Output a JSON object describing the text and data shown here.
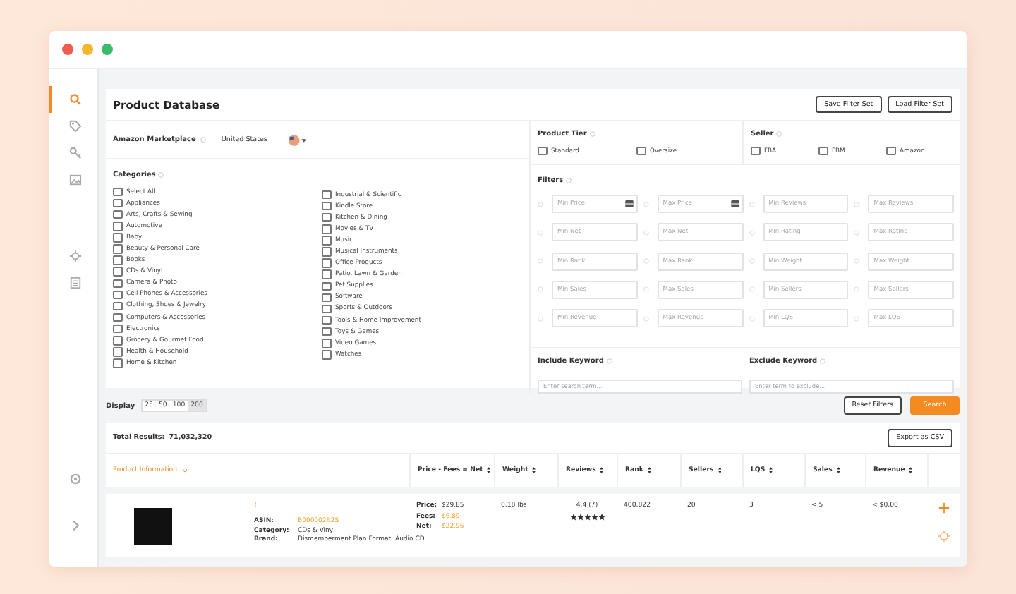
{
  "window_controls": [
    {
      "color": "#ee5b4f"
    },
    {
      "color": "#f4b52f"
    },
    {
      "color": "#3dbb6b"
    }
  ],
  "sidebar": {
    "items": [
      {
        "kind": "search",
        "selected": true
      },
      {
        "kind": "tag",
        "selected": false
      },
      {
        "kind": "key",
        "selected": false
      },
      {
        "kind": "image",
        "selected": false
      },
      {
        "kind": "crosshair",
        "selected": false
      },
      {
        "kind": "list",
        "selected": false
      }
    ],
    "bottom_items": [
      {
        "kind": "settings",
        "selected": false
      },
      {
        "kind": "expand",
        "selected": false
      }
    ]
  },
  "header": {
    "title": "Product Database",
    "buttons": [
      "Save Filter Set",
      "Load Filter Set"
    ]
  },
  "marketplace": {
    "label": "Amazon Marketplace",
    "value": "United States"
  },
  "categories": {
    "label": "Categories",
    "columns": [
      [
        {
          "label": "Select All",
          "checked": false
        },
        {
          "label": "Appliances",
          "checked": false
        },
        {
          "label": "Arts, Crafts & Sewing",
          "checked": false
        },
        {
          "label": "Automotive",
          "checked": false
        },
        {
          "label": "Baby",
          "checked": false
        },
        {
          "label": "Beauty & Personal Care",
          "checked": false
        },
        {
          "label": "Books",
          "checked": false
        },
        {
          "label": "CDs & Vinyl",
          "checked": false
        },
        {
          "label": "Camera & Photo",
          "checked": false
        },
        {
          "label": "Cell Phones & Accessories",
          "checked": false
        },
        {
          "label": "Clothing, Shoes & Jewelry",
          "checked": false
        },
        {
          "label": "Computers & Accessories",
          "checked": false
        },
        {
          "label": "Electronics",
          "checked": false
        },
        {
          "label": "Grocery & Gourmet Food",
          "checked": false
        },
        {
          "label": "Health & Household",
          "checked": false
        },
        {
          "label": "Home & Kitchen",
          "checked": false
        }
      ],
      [
        {
          "label": "Industrial & Scientific",
          "checked": false
        },
        {
          "label": "Kindle Store",
          "checked": false
        },
        {
          "label": "Kitchen & Dining",
          "checked": false
        },
        {
          "label": "Movies & TV",
          "checked": false
        },
        {
          "label": "Music",
          "checked": false
        },
        {
          "label": "Musical Instruments",
          "checked": false
        },
        {
          "label": "Office Products",
          "checked": false
        },
        {
          "label": "Patio, Lawn & Garden",
          "checked": false
        },
        {
          "label": "Pet Supplies",
          "checked": false
        },
        {
          "label": "Software",
          "checked": false
        },
        {
          "label": "Sports & Outdoors",
          "checked": false
        },
        {
          "label": "Tools & Home Improvement",
          "checked": false
        },
        {
          "label": "Toys & Games",
          "checked": false
        },
        {
          "label": "Video Games",
          "checked": false
        },
        {
          "label": "Watches",
          "checked": false
        }
      ]
    ]
  },
  "product_tier": {
    "label": "Product Tier",
    "options": [
      {
        "label": "Standard",
        "checked": false
      },
      {
        "label": "Oversize",
        "checked": false
      }
    ]
  },
  "seller": {
    "label": "Seller",
    "options": [
      {
        "label": "FBA",
        "checked": false
      },
      {
        "label": "FBM",
        "checked": false
      },
      {
        "label": "Amazon",
        "checked": false
      }
    ]
  },
  "filters": {
    "label": "Filters",
    "fields": [
      {
        "placeholder": "Min Price",
        "kind": "price"
      },
      {
        "placeholder": "Max Price",
        "kind": "price"
      },
      {
        "placeholder": "Min Reviews",
        "kind": "plain"
      },
      {
        "placeholder": "Max Reviews",
        "kind": "plain"
      },
      {
        "placeholder": "Min Net",
        "kind": "plain"
      },
      {
        "placeholder": "Max Net",
        "kind": "plain"
      },
      {
        "placeholder": "Min Rating",
        "kind": "plain"
      },
      {
        "placeholder": "Max Rating",
        "kind": "plain"
      },
      {
        "placeholder": "Min Rank",
        "kind": "plain"
      },
      {
        "placeholder": "Max Rank",
        "kind": "plain"
      },
      {
        "placeholder": "Min Weight",
        "kind": "plain"
      },
      {
        "placeholder": "Max Weight",
        "kind": "plain"
      },
      {
        "placeholder": "Min Sales",
        "kind": "plain"
      },
      {
        "placeholder": "Max Sales",
        "kind": "plain"
      },
      {
        "placeholder": "Min Sellers",
        "kind": "plain"
      },
      {
        "placeholder": "Max Sellers",
        "kind": "plain"
      },
      {
        "placeholder": "Min Revenue",
        "kind": "plain"
      },
      {
        "placeholder": "Max Revenue",
        "kind": "plain"
      },
      {
        "placeholder": "Min LQS",
        "kind": "plain"
      },
      {
        "placeholder": "Max LQS",
        "kind": "plain"
      }
    ]
  },
  "include_keyword": {
    "label": "Include Keyword",
    "placeholder": "Enter search term..."
  },
  "exclude_keyword": {
    "label": "Exclude Keyword",
    "placeholder": "Enter term to exclude..."
  },
  "display": {
    "label": "Display",
    "options": [
      {
        "label": "25",
        "selected": false
      },
      {
        "label": "50",
        "selected": false
      },
      {
        "label": "100",
        "selected": false
      },
      {
        "label": "200",
        "selected": true
      }
    ]
  },
  "actions": {
    "reset": "Reset Filters",
    "search": "Search"
  },
  "results": {
    "total_label": "Total Results:",
    "total": "71,032,320",
    "export": "Export as CSV",
    "columns": [
      {
        "label": "Product Information",
        "kind": "primary"
      },
      {
        "label": "Price - Fees = Net",
        "kind": "sortable"
      },
      {
        "label": "Weight",
        "kind": "sortable"
      },
      {
        "label": "Reviews",
        "kind": "sortable"
      },
      {
        "label": "Rank",
        "kind": "sortable"
      },
      {
        "label": "Sellers",
        "kind": "sortable"
      },
      {
        "label": "LQS",
        "kind": "sortable"
      },
      {
        "label": "Sales",
        "kind": "sortable"
      },
      {
        "label": "Revenue",
        "kind": "sortable"
      }
    ]
  },
  "products": [
    {
      "title": "!",
      "asin_label": "ASIN:",
      "asin": "B000002R2S",
      "category_label": "Category:",
      "category": "CDs & Vinyl",
      "brand_label": "Brand:",
      "brand": "Dismemberment Plan Format: Audio CD",
      "price_label": "Price:",
      "price": "$29.85",
      "fees_label": "Fees:",
      "fees": "$6.89",
      "net_label": "Net:",
      "net": "$22.96",
      "weight": "0.18 lbs",
      "reviews": "4.4 (7)",
      "stars": 5,
      "rank": "400,822",
      "sellers": "20",
      "lqs": "3",
      "sales": "< 5",
      "revenue": "< $0.00"
    }
  ]
}
